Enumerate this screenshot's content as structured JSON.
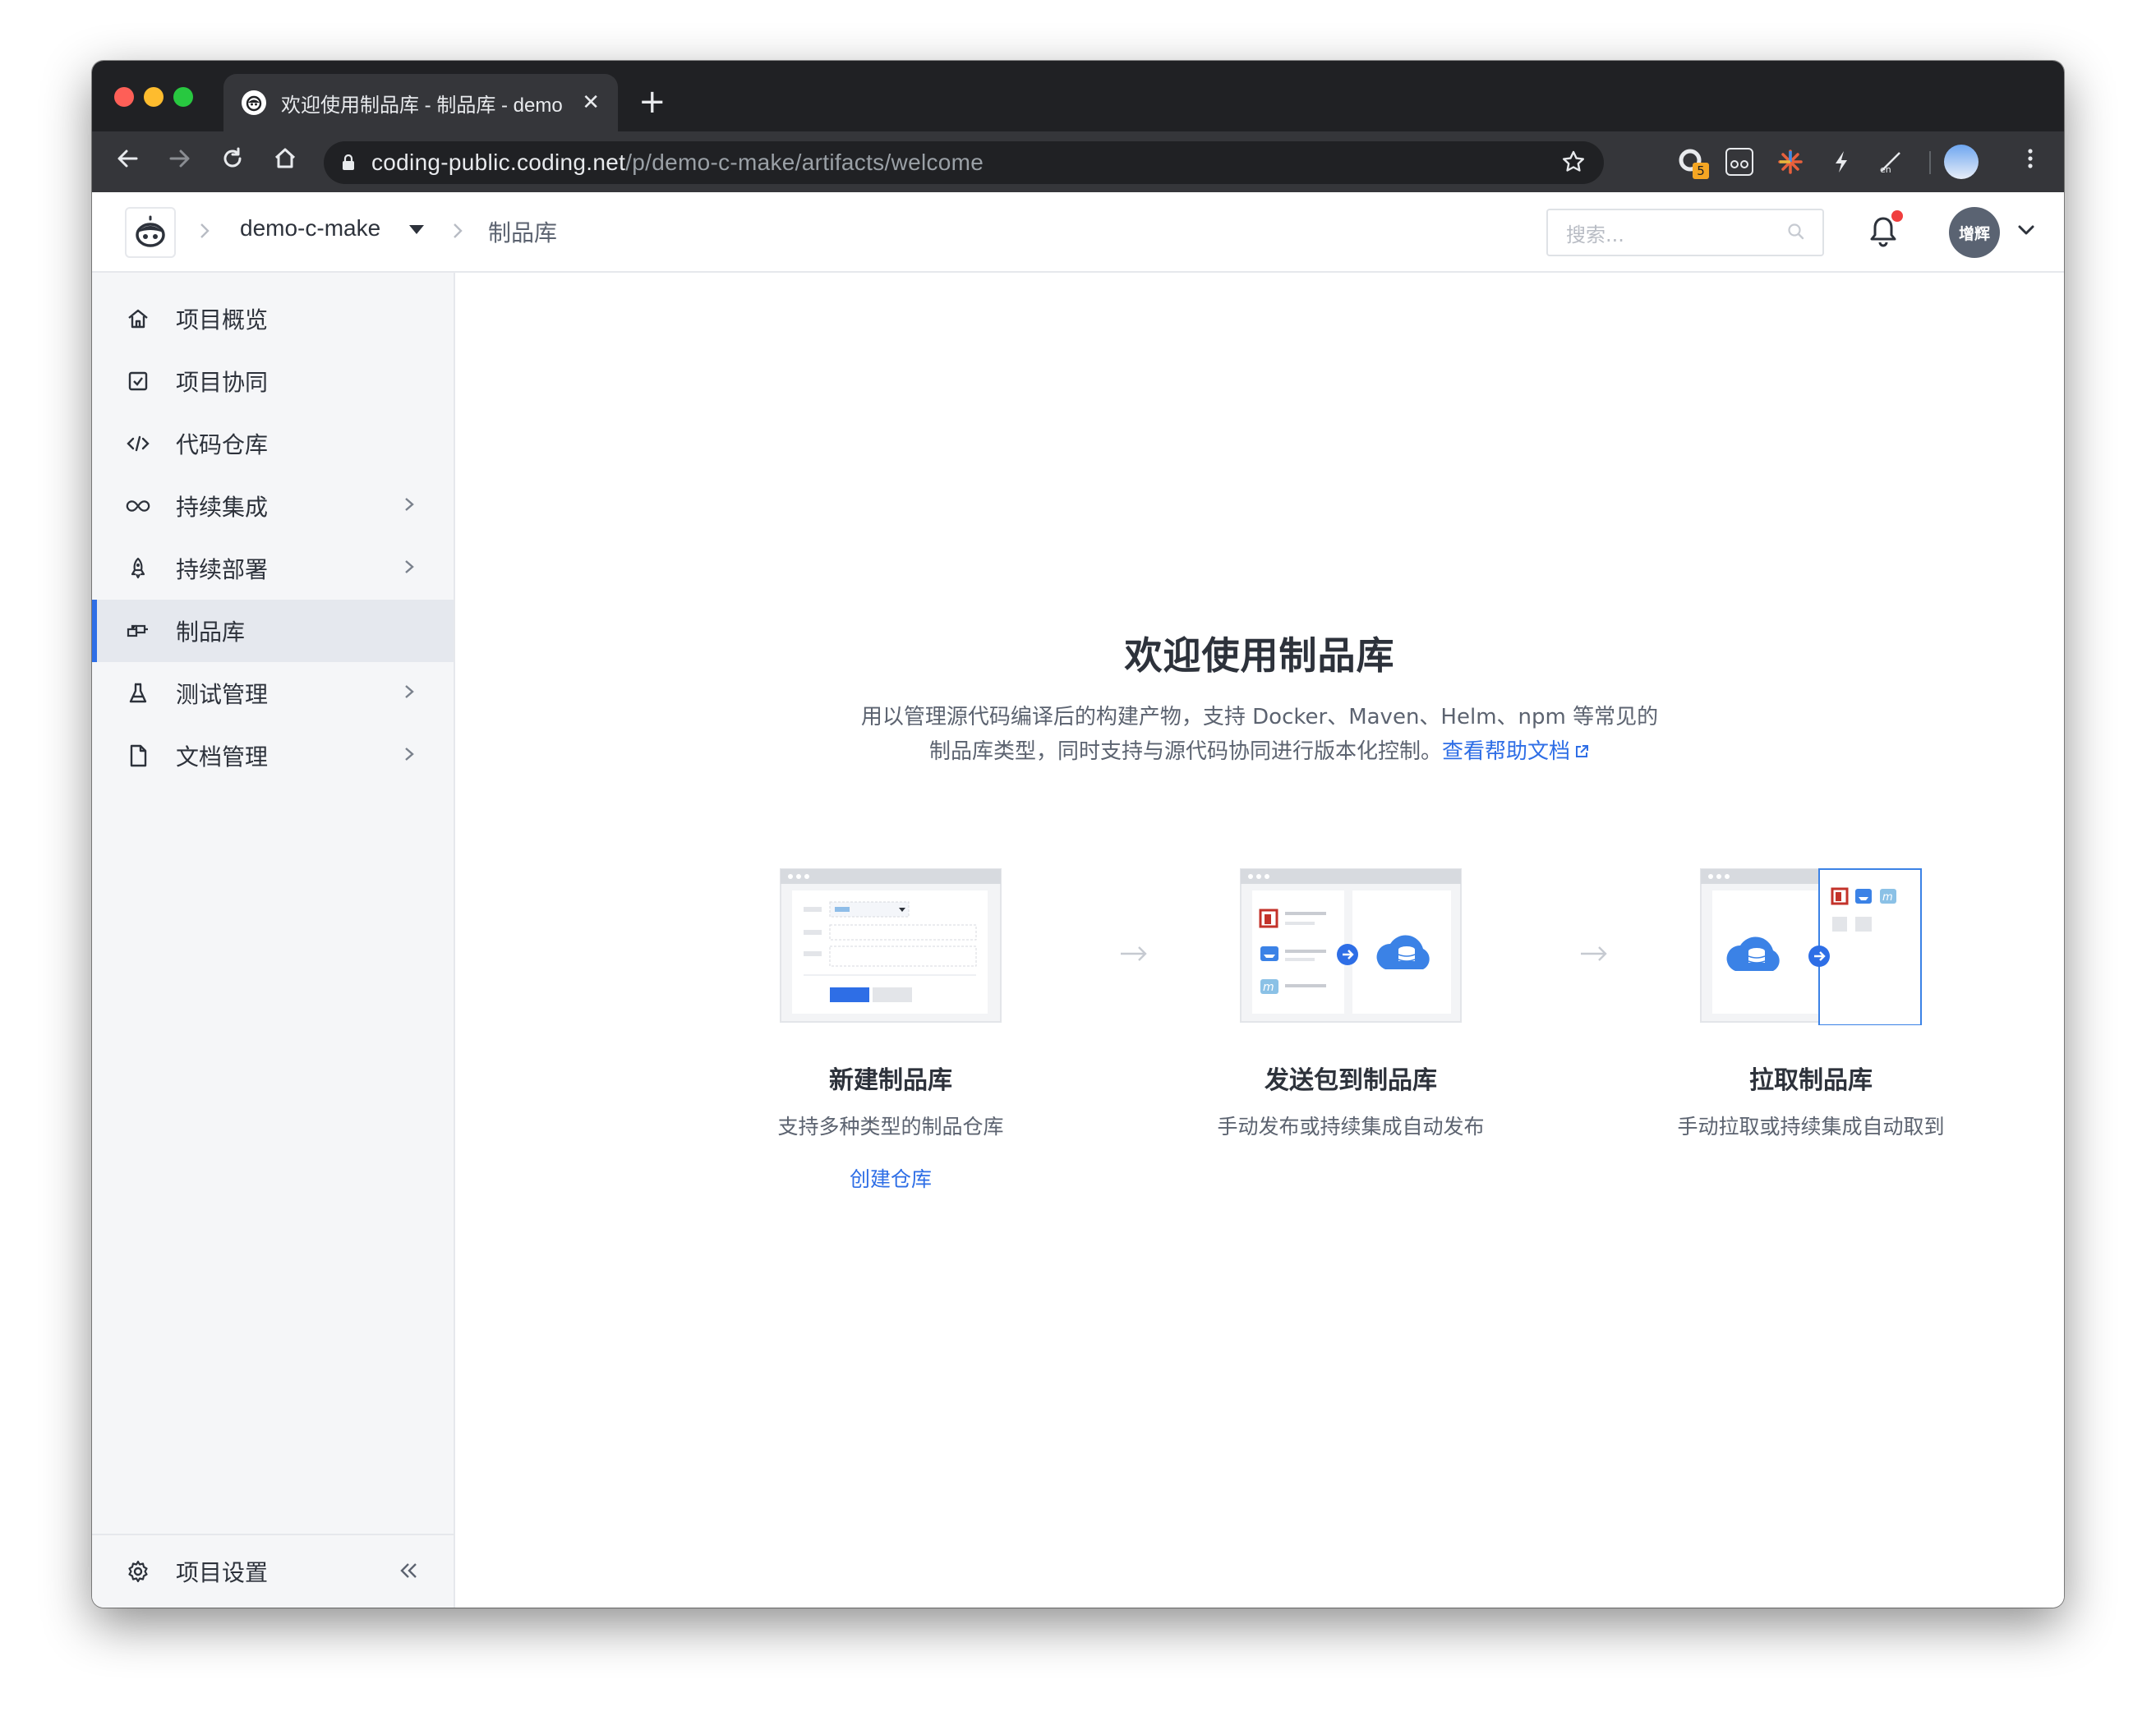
{
  "browser": {
    "tab_title": "欢迎使用制品库 - 制品库 - demo",
    "tab_close": "✕",
    "new_tab": "+",
    "url_host": "coding-public.coding.net",
    "url_path": "/p/demo-c-make/artifacts/welcome",
    "ext_badge": "5"
  },
  "header": {
    "project_name": "demo-c-make",
    "page_name": "制品库",
    "search_placeholder": "搜索...",
    "avatar_text": "增辉"
  },
  "sidebar": {
    "items": [
      {
        "label": "项目概览",
        "icon": "home-icon",
        "has_children": false
      },
      {
        "label": "项目协同",
        "icon": "checkbox-icon",
        "has_children": false
      },
      {
        "label": "代码仓库",
        "icon": "code-icon",
        "has_children": false
      },
      {
        "label": "持续集成",
        "icon": "infinity-icon",
        "has_children": true
      },
      {
        "label": "持续部署",
        "icon": "rocket-icon",
        "has_children": true
      },
      {
        "label": "制品库",
        "icon": "artifact-icon",
        "has_children": false,
        "active": true
      },
      {
        "label": "测试管理",
        "icon": "flask-icon",
        "has_children": true
      },
      {
        "label": "文档管理",
        "icon": "document-icon",
        "has_children": true
      }
    ],
    "settings_label": "项目设置"
  },
  "main": {
    "title": "欢迎使用制品库",
    "desc_line1": "用以管理源代码编译后的构建产物，支持 Docker、Maven、Helm、npm 等常见的",
    "desc_line2": "制品库类型，同时支持与源代码协同进行版本化控制。",
    "help_link": "查看帮助文档",
    "steps": [
      {
        "title": "新建制品库",
        "desc": "支持多种类型的制品仓库",
        "link": "创建仓库"
      },
      {
        "title": "发送包到制品库",
        "desc": "手动发布或持续集成自动发布"
      },
      {
        "title": "拉取制品库",
        "desc": "手动拉取或持续集成自动取到"
      }
    ]
  },
  "colors": {
    "accent": "#2e6ee6",
    "sidebar_bg": "#f5f6f8",
    "chrome_dark": "#202124"
  }
}
